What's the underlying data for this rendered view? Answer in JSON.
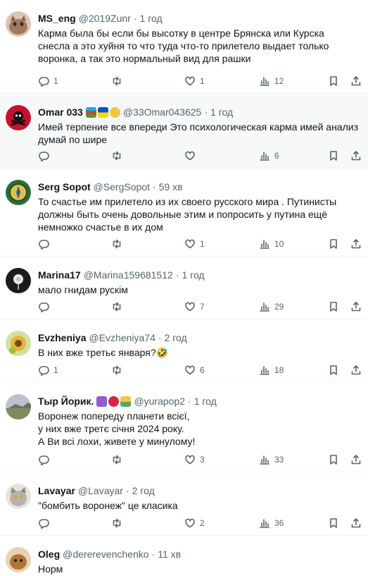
{
  "replies": [
    {
      "name": "MS_eng",
      "handle": "@2019Zunr",
      "time": "1 год",
      "text": "Карма была бы если бы высотку в центре Брянска или Курска снесла а это хуйня то что туда что-то прилетело выдает только воронка, а так это нормальный вид для рашки",
      "replies": "1",
      "retweets": "",
      "likes": "1",
      "views": "12",
      "avatar_color": "#a3785d"
    },
    {
      "name": "Omar 033",
      "handle": "@33Omar043625",
      "time": "1 год",
      "text": "Имей терпение все впереди Это психологическая карма имей анализ думай по шире",
      "replies": "",
      "retweets": "",
      "likes": "",
      "views": "6",
      "avatar_color": "#c8102e"
    },
    {
      "name": "Serg Sopot",
      "handle": "@SergSopot",
      "time": "59 хв",
      "text": "То счастье им прилетело  из их своего русского мира . Путинисты должны быть очень довольные этим и попросить у путина ещё немножко счастье в их дом",
      "replies": "",
      "retweets": "",
      "likes": "1",
      "views": "10",
      "avatar_color": "#2e6b3a"
    },
    {
      "name": "Marina17",
      "handle": "@Marina159681512",
      "time": "1 год",
      "text": "мало гнидам рускім",
      "replies": "",
      "retweets": "",
      "likes": "7",
      "views": "29",
      "avatar_color": "#1b1b1b"
    },
    {
      "name": "Evzheniya",
      "handle": "@Evzheniya74",
      "time": "2 год",
      "text": "В них вже третьє января?🤣",
      "replies": "1",
      "retweets": "",
      "likes": "6",
      "views": "18",
      "avatar_color": "#9bbf3a"
    },
    {
      "name": "Тыр Йорик.",
      "handle": "@yurapop2",
      "time": "1 год",
      "text": "Воронеж попереду планети всієї,\nу них вже третє січня 2024 року.\nА Ви всі лохи, живете у минулому!",
      "replies": "",
      "retweets": "",
      "likes": "3",
      "views": "33",
      "avatar_color": "#8a8f7c"
    },
    {
      "name": "Lavayar",
      "handle": "@Lavayar",
      "time": "2 год",
      "text": "\"бомбить воронеж\" це класика",
      "replies": "",
      "retweets": "",
      "likes": "2",
      "views": "36",
      "avatar_color": "#b7b2aa"
    },
    {
      "name": "Oleg",
      "handle": "@dererevenchenko",
      "time": "11 хв",
      "text": "Норм",
      "replies": "",
      "retweets": "",
      "likes": "",
      "views": "",
      "avatar_color": "#b0743a"
    }
  ]
}
